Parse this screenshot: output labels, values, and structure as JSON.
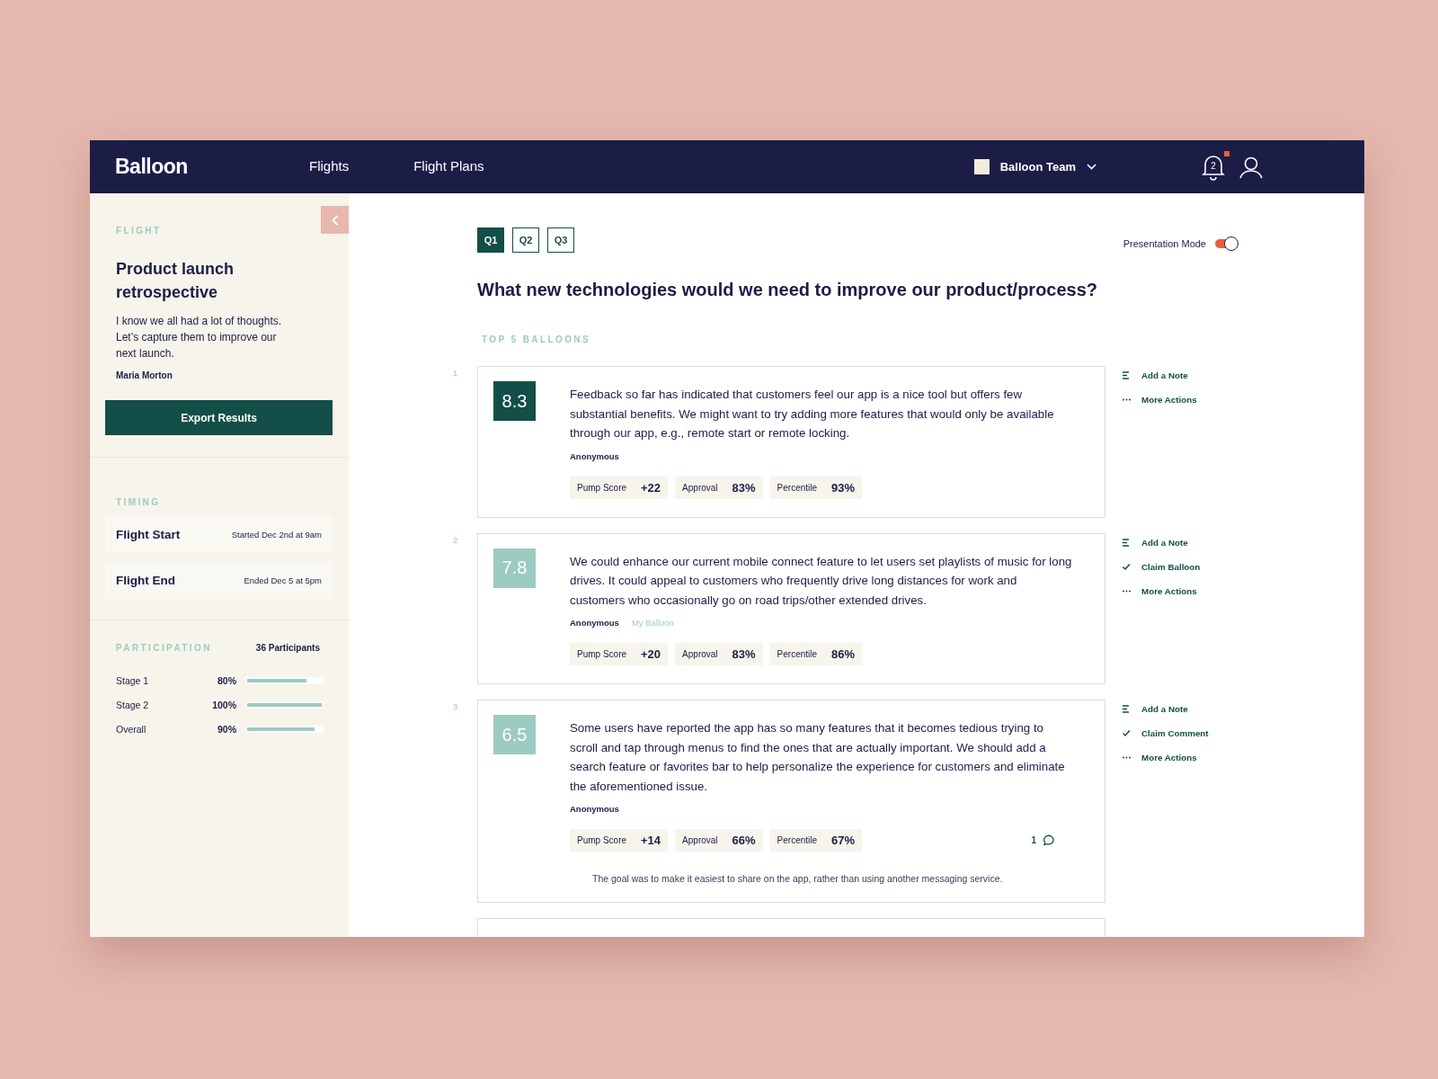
{
  "header": {
    "logo": "Balloon",
    "nav": [
      {
        "label": "Flights",
        "selected": false
      },
      {
        "label": "Flight Plans",
        "selected": false
      }
    ],
    "team": {
      "name": "Balloon Team"
    },
    "notifications": {
      "count": "2",
      "unread": true
    }
  },
  "sidebar": {
    "flight": {
      "label": "FLIGHT",
      "title": "Product launch retrospective",
      "description": "I know we all had a lot of thoughts. Let’s capture them to improve our next launch.",
      "author": "Maria Morton",
      "button": "Export Results"
    },
    "timing": {
      "label": "TIMING",
      "rows": [
        {
          "name": "Flight Start",
          "value": "Started Dec 2nd at 9am"
        },
        {
          "name": "Flight End",
          "value": "Ended Dec 5 at 5pm"
        }
      ]
    },
    "participation": {
      "label": "PARTICIPATION",
      "total": "36 Participants",
      "stages": [
        {
          "name": "Stage 1",
          "value": "80%",
          "level": 0.8
        },
        {
          "name": "Stage 2",
          "value": "100%",
          "level": 1
        },
        {
          "name": "Overall",
          "value": "90%",
          "level": 0.9
        }
      ]
    }
  },
  "main": {
    "question_tabs": [
      {
        "label": "Q1",
        "selected": true
      },
      {
        "label": "Q2",
        "selected": false
      },
      {
        "label": "Q3",
        "selected": false
      }
    ],
    "presentation_mode": {
      "label": "Presentation Mode",
      "on": true
    },
    "question": "What new technologies would we need to improve our product/process?",
    "section_label": "TOP 5 BALLOONS",
    "balloons": [
      {
        "rank": "1",
        "score": "8.3",
        "highlighted": true,
        "text": "Feedback so far has indicated that customers feel our app is a nice tool but offers few substantial benefits. We might want to try adding more features that would only be available through our app, e.g., remote start or remote locking.",
        "author": "Anonymous",
        "stats": [
          {
            "label": "Pump Score",
            "value": "+22"
          },
          {
            "label": "Approval",
            "value": "83%"
          },
          {
            "label": "Percentile",
            "value": "93%"
          }
        ],
        "actions": [
          {
            "kind": "note",
            "label": "Add a Note"
          },
          {
            "kind": "more",
            "label": "More Actions"
          }
        ]
      },
      {
        "rank": "2",
        "score": "7.8",
        "highlighted": false,
        "text": "We could enhance our current mobile connect feature to let users set playlists of music for long drives. It could appeal to customers who frequently drive long distances for work and customers who occasionally go on road trips/other extended drives.",
        "author": "Anonymous",
        "tag": "My Balloon",
        "stats": [
          {
            "label": "Pump Score",
            "value": "+20"
          },
          {
            "label": "Approval",
            "value": "83%"
          },
          {
            "label": "Percentile",
            "value": "86%"
          }
        ],
        "actions": [
          {
            "kind": "note",
            "label": "Add a Note"
          },
          {
            "kind": "claim",
            "label": "Claim Balloon"
          },
          {
            "kind": "more",
            "label": "More Actions"
          }
        ]
      },
      {
        "rank": "3",
        "score": "6.5",
        "highlighted": false,
        "text": "Some users have reported the app has so many features that it becomes tedious trying to scroll and tap through menus to find the ones that are actually important. We should add a search feature or favorites bar to help personalize the experience for customers and eliminate the aforementioned issue.",
        "author": "Anonymous",
        "stats": [
          {
            "label": "Pump Score",
            "value": "+14"
          },
          {
            "label": "Approval",
            "value": "66%"
          },
          {
            "label": "Percentile",
            "value": "67%"
          }
        ],
        "comments": "1",
        "note": "The goal was to make it easiest to share on the app, rather than using another messaging service.",
        "actions": [
          {
            "kind": "note",
            "label": "Add a Note"
          },
          {
            "kind": "claim",
            "label": "Claim Comment"
          },
          {
            "kind": "more",
            "label": "More Actions"
          }
        ]
      }
    ]
  }
}
